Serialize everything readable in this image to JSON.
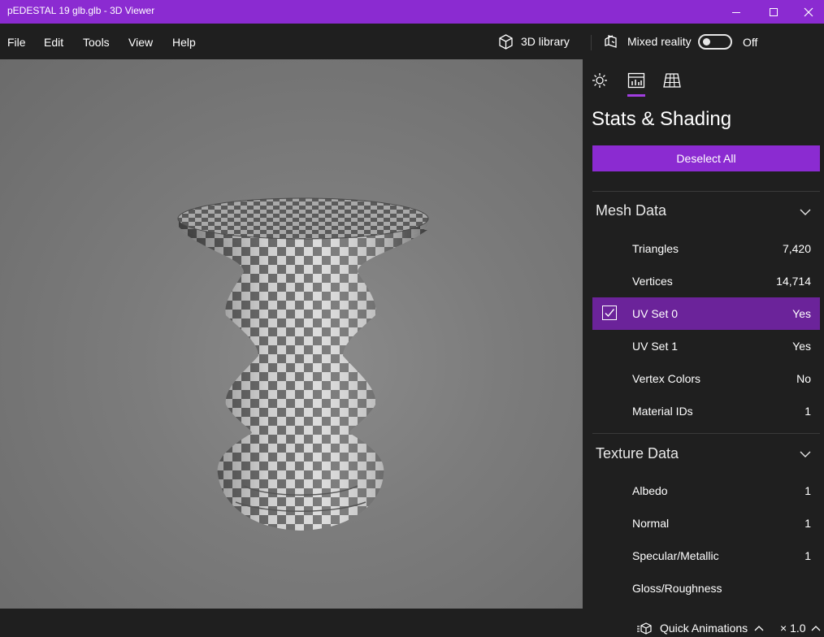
{
  "window": {
    "title": "pEDESTAL 19 glb.glb - 3D Viewer",
    "accent": "#8b2bd1"
  },
  "menu": {
    "items": [
      "File",
      "Edit",
      "Tools",
      "View",
      "Help"
    ],
    "library_label": "3D library",
    "mixed_reality_label": "Mixed reality",
    "toggle_state": "Off"
  },
  "panel": {
    "tabs": [
      {
        "icon": "sun-icon"
      },
      {
        "icon": "stats-icon",
        "active": true
      },
      {
        "icon": "grid-icon"
      }
    ],
    "title": "Stats & Shading",
    "deselect_label": "Deselect All",
    "mesh": {
      "header": "Mesh Data",
      "rows": [
        {
          "label": "Triangles",
          "value": "7,420"
        },
        {
          "label": "Vertices",
          "value": "14,714"
        },
        {
          "label": "UV Set 0",
          "value": "Yes",
          "selected": true
        },
        {
          "label": "UV Set 1",
          "value": "Yes"
        },
        {
          "label": "Vertex Colors",
          "value": "No"
        },
        {
          "label": "Material IDs",
          "value": "1"
        }
      ]
    },
    "texture": {
      "header": "Texture Data",
      "rows": [
        {
          "label": "Albedo",
          "value": "1"
        },
        {
          "label": "Normal",
          "value": "1"
        },
        {
          "label": "Specular/Metallic",
          "value": "1"
        },
        {
          "label": "Gloss/Roughness",
          "value": ""
        }
      ]
    }
  },
  "bottom": {
    "quick_animations_label": "Quick Animations",
    "speed": "× 1.0"
  }
}
